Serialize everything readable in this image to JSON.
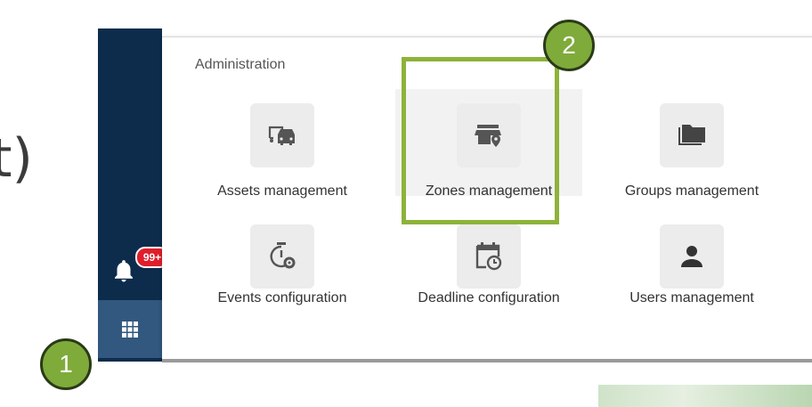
{
  "background": {
    "partial_text": "t)"
  },
  "sidebar": {
    "notification_badge": "99+",
    "apps_button_icon": "grid-icon"
  },
  "menu": {
    "section_title": "Administration",
    "items": [
      {
        "label": "Assets management",
        "icon": "car-icon"
      },
      {
        "label": "Zones management",
        "icon": "zone-pin-icon"
      },
      {
        "label": "Groups management",
        "icon": "folder-icon"
      },
      {
        "label": "Events configuration",
        "icon": "timer-gear-icon"
      },
      {
        "label": "Deadline configuration",
        "icon": "calendar-clock-icon"
      },
      {
        "label": "Users management",
        "icon": "user-icon"
      }
    ]
  },
  "annotations": [
    {
      "label": "1"
    },
    {
      "label": "2"
    }
  ],
  "colors": {
    "sidebar_bg": "#0d2c4c",
    "apps_button_bg": "#32587f",
    "badge_red": "#e01e2b",
    "callout_green": "#7fab3a",
    "highlight_green": "#8db33a"
  }
}
